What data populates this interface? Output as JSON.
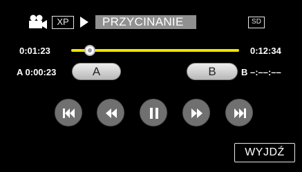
{
  "header": {
    "camera_icon": "video-camera-icon",
    "quality_badge": "XP",
    "play_icon": "play-triangle-icon",
    "mode_title": "PRZYCINANIE",
    "media_badge": "SD"
  },
  "timeline": {
    "current_time": "0:01:23",
    "total_time": "0:12:34",
    "position_fraction": 0.11,
    "accent_color": "#f2e300"
  },
  "trim_points": {
    "a_label": "A 0:00:23",
    "a_button": "A",
    "b_button": "B",
    "b_label": "B –:––:––"
  },
  "controls": [
    {
      "name": "skip-previous-icon"
    },
    {
      "name": "rewind-icon"
    },
    {
      "name": "pause-icon"
    },
    {
      "name": "fast-forward-icon"
    },
    {
      "name": "skip-next-icon"
    }
  ],
  "footer": {
    "exit_label": "WYJDŹ"
  }
}
